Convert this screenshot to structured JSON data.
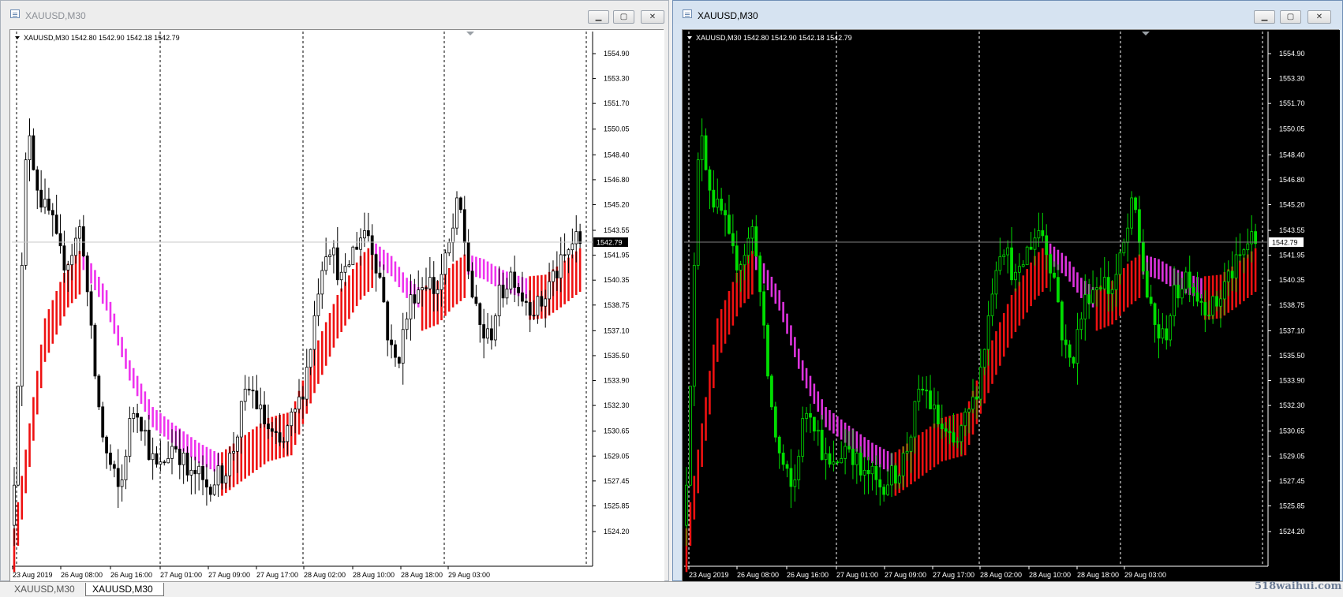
{
  "windows": [
    {
      "title": "XAUUSD,M30",
      "theme": {
        "bg": "#ffffff",
        "fg": "#000000",
        "grid": "#000000",
        "candle": "#000000",
        "bull": "#ffffff",
        "bear": "#000000",
        "upColor": "#ee1111",
        "downColor": "#ee33ee",
        "lineColor": "#c8c8c8",
        "axisBg": "#ffffff"
      },
      "info": "XAUUSD,M30  1542.80 1542.90 1542.18 1542.79",
      "current_price_label": "1542.79",
      "y_ticks": [
        "1554.90",
        "1553.30",
        "1551.70",
        "1550.05",
        "1548.40",
        "1546.80",
        "1545.20",
        "1543.55",
        "1541.95",
        "1540.35",
        "1538.75",
        "1537.10",
        "1535.50",
        "1533.90",
        "1532.30",
        "1530.65",
        "1529.05",
        "1527.45",
        "1525.85",
        "1524.20"
      ],
      "x_ticks": [
        "23 Aug 2019",
        "26 Aug 08:00",
        "26 Aug 16:00",
        "27 Aug 01:00",
        "27 Aug 09:00",
        "27 Aug 17:00",
        "28 Aug 02:00",
        "28 Aug 10:00",
        "28 Aug 18:00",
        "29 Aug 03:00"
      ],
      "controls": {
        "minimize": "▁",
        "maximize": "▢",
        "close": "✕"
      }
    },
    {
      "title": "XAUUSD,M30",
      "theme": {
        "bg": "#000000",
        "fg": "#ffffff",
        "grid": "#ffffff",
        "candle": "#00dd00",
        "bull": "#000000",
        "bear": "#00dd00",
        "upColor": "#ee1111",
        "downColor": "#dd33dd",
        "lineColor": "#808080",
        "axisBg": "#000000"
      },
      "info": "XAUUSD,M30  1542.80 1542.90 1542.18 1542.79",
      "current_price_label": "1542.79",
      "y_ticks": [
        "1554.90",
        "1553.30",
        "1551.70",
        "1550.05",
        "1548.40",
        "1546.80",
        "1545.20",
        "1543.55",
        "1541.95",
        "1540.35",
        "1538.75",
        "1537.10",
        "1535.50",
        "1533.90",
        "1532.30",
        "1530.65",
        "1529.05",
        "1527.45",
        "1525.85",
        "1524.20"
      ],
      "x_ticks": [
        "23 Aug 2019",
        "26 Aug 08:00",
        "26 Aug 16:00",
        "27 Aug 01:00",
        "27 Aug 09:00",
        "27 Aug 17:00",
        "28 Aug 02:00",
        "28 Aug 10:00",
        "28 Aug 18:00",
        "29 Aug 03:00"
      ],
      "controls": {
        "minimize": "▁",
        "maximize": "▢",
        "close": "✕"
      }
    }
  ],
  "tabs": [
    "XAUUSD,M30",
    "XAUUSD,M30"
  ],
  "watermark": "518waihui.com",
  "chart_data": {
    "type": "candlestick",
    "symbol": "XAUUSD",
    "timeframe": "M30",
    "ylim": [
      1524.2,
      1554.9
    ],
    "current_price": 1542.79,
    "ohlc_last": {
      "open": 1542.8,
      "high": 1542.9,
      "low": 1542.18,
      "close": 1542.79
    },
    "close_path": [
      [
        0,
        1524.6
      ],
      [
        2,
        1537.5
      ],
      [
        4,
        1551.0
      ],
      [
        6,
        1547.0
      ],
      [
        8,
        1545.0
      ],
      [
        10,
        1544.5
      ],
      [
        12,
        1542.0
      ],
      [
        14,
        1541.5
      ],
      [
        16,
        1542.5
      ],
      [
        18,
        1544.0
      ],
      [
        20,
        1538.0
      ],
      [
        22,
        1533.0
      ],
      [
        24,
        1529.5
      ],
      [
        26,
        1528.0
      ],
      [
        28,
        1526.5
      ],
      [
        30,
        1530.5
      ],
      [
        32,
        1532.5
      ],
      [
        34,
        1531.0
      ],
      [
        36,
        1529.0
      ],
      [
        38,
        1528.0
      ],
      [
        40,
        1529.0
      ],
      [
        42,
        1530.0
      ],
      [
        44,
        1529.0
      ],
      [
        46,
        1527.5
      ],
      [
        48,
        1528.0
      ],
      [
        50,
        1527.0
      ],
      [
        52,
        1527.5
      ],
      [
        54,
        1527.8
      ],
      [
        56,
        1528.5
      ],
      [
        58,
        1530.0
      ],
      [
        60,
        1532.5
      ],
      [
        62,
        1533.5
      ],
      [
        64,
        1532.0
      ],
      [
        66,
        1531.0
      ],
      [
        68,
        1530.0
      ],
      [
        70,
        1529.5
      ],
      [
        72,
        1531.0
      ],
      [
        74,
        1532.0
      ],
      [
        76,
        1534.0
      ],
      [
        78,
        1537.0
      ],
      [
        80,
        1541.0
      ],
      [
        82,
        1543.0
      ],
      [
        84,
        1541.5
      ],
      [
        86,
        1540.0
      ],
      [
        88,
        1542.0
      ],
      [
        90,
        1543.0
      ],
      [
        92,
        1543.8
      ],
      [
        94,
        1542.0
      ],
      [
        96,
        1540.0
      ],
      [
        98,
        1536.0
      ],
      [
        100,
        1535.0
      ],
      [
        102,
        1537.5
      ],
      [
        104,
        1539.5
      ],
      [
        106,
        1540.0
      ],
      [
        108,
        1540.5
      ],
      [
        110,
        1539.5
      ],
      [
        112,
        1541.0
      ],
      [
        114,
        1543.0
      ],
      [
        116,
        1545.5
      ],
      [
        118,
        1542.0
      ],
      [
        120,
        1538.5
      ],
      [
        122,
        1537.0
      ],
      [
        124,
        1536.5
      ],
      [
        126,
        1539.0
      ],
      [
        128,
        1540.0
      ],
      [
        130,
        1541.0
      ],
      [
        132,
        1539.5
      ],
      [
        134,
        1539.0
      ],
      [
        136,
        1538.5
      ],
      [
        138,
        1539.0
      ],
      [
        140,
        1540.5
      ],
      [
        142,
        1541.0
      ],
      [
        144,
        1542.0
      ],
      [
        146,
        1543.0
      ],
      [
        147,
        1542.79
      ]
    ],
    "indicator_path": [
      [
        0,
        1523.5
      ],
      [
        8,
        1537.0
      ],
      [
        14,
        1540.5
      ],
      [
        18,
        1541.6
      ],
      [
        24,
        1539.0
      ],
      [
        30,
        1534.5
      ],
      [
        36,
        1531.5
      ],
      [
        42,
        1530.3
      ],
      [
        48,
        1529.2
      ],
      [
        54,
        1528.4
      ],
      [
        60,
        1529.5
      ],
      [
        66,
        1530.6
      ],
      [
        72,
        1531.0
      ],
      [
        78,
        1535.0
      ],
      [
        84,
        1538.5
      ],
      [
        90,
        1541.0
      ],
      [
        94,
        1542.0
      ],
      [
        98,
        1541.2
      ],
      [
        102,
        1539.8
      ],
      [
        106,
        1539.0
      ],
      [
        110,
        1539.4
      ],
      [
        114,
        1540.5
      ],
      [
        118,
        1541.3
      ],
      [
        122,
        1541.0
      ],
      [
        126,
        1540.4
      ],
      [
        130,
        1540.0
      ],
      [
        134,
        1539.7
      ],
      [
        138,
        1539.8
      ],
      [
        142,
        1540.5
      ],
      [
        147,
        1541.5
      ]
    ],
    "indicator_up_color": "#ee1111",
    "indicator_down_color": "#ee33ee"
  }
}
